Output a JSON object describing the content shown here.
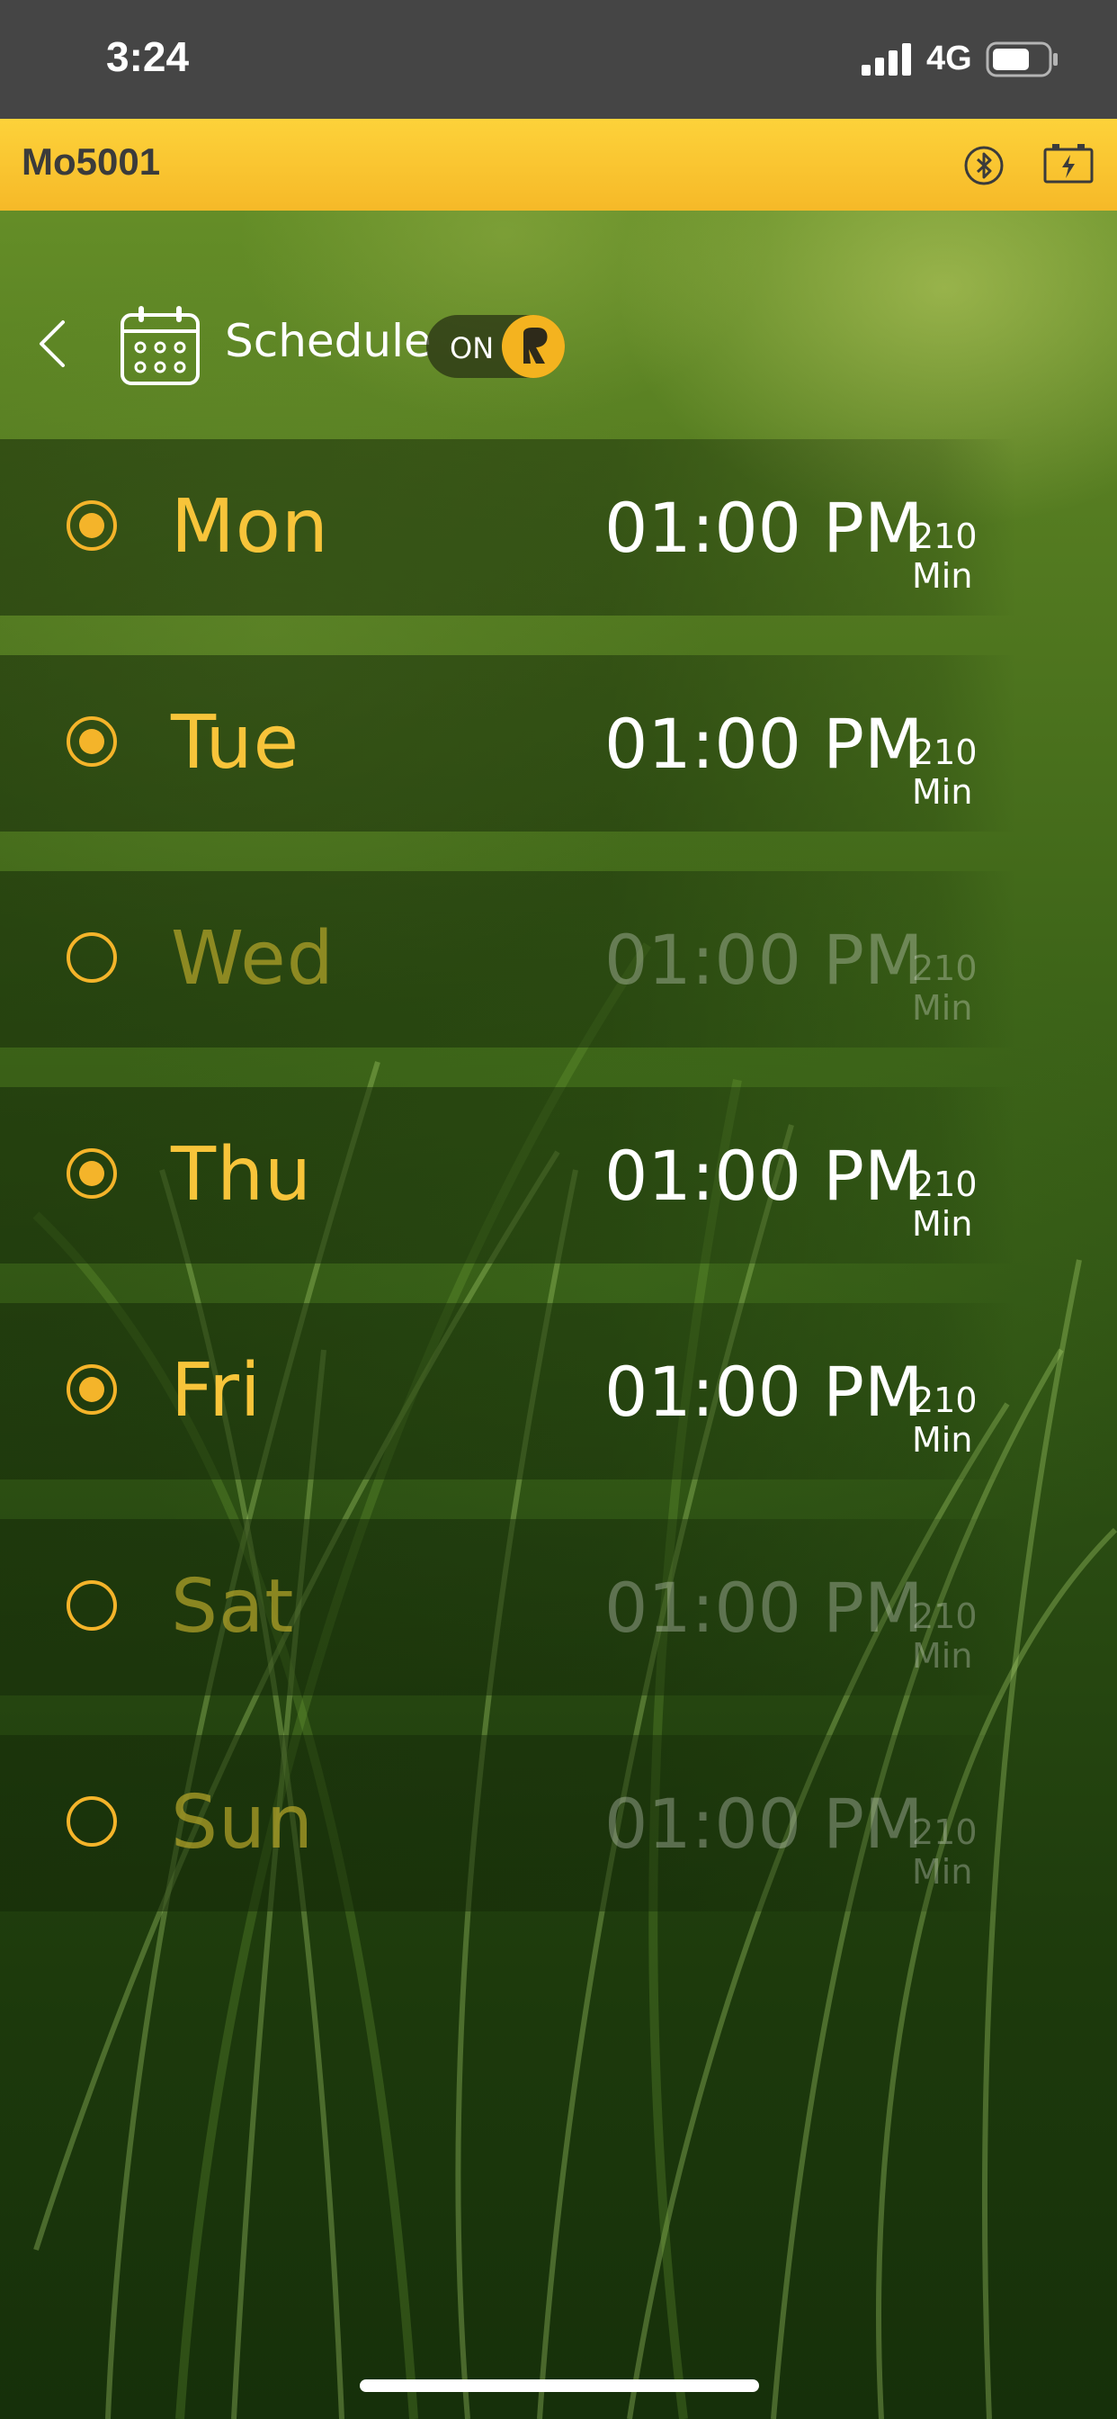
{
  "status_bar": {
    "time": "3:24",
    "network": "4G",
    "icons": [
      "signal-icon",
      "battery-icon"
    ]
  },
  "header": {
    "device_name": "Mo5001",
    "icons": [
      "bluetooth-icon",
      "battery-charge-icon"
    ],
    "background_color": "#f9c531"
  },
  "schedule": {
    "title": "Schedule",
    "toggle_label": "ON",
    "toggle_on": true,
    "accent_color": "#f4b42a",
    "days": [
      {
        "day": "Mon",
        "time": "01:00 PM",
        "duration": "210 Min",
        "enabled": true
      },
      {
        "day": "Tue",
        "time": "01:00 PM",
        "duration": "210 Min",
        "enabled": true
      },
      {
        "day": "Wed",
        "time": "01:00 PM",
        "duration": "210 Min",
        "enabled": false
      },
      {
        "day": "Thu",
        "time": "01:00 PM",
        "duration": "210 Min",
        "enabled": true
      },
      {
        "day": "Fri",
        "time": "01:00 PM",
        "duration": "210 Min",
        "enabled": true
      },
      {
        "day": "Sat",
        "time": "01:00 PM",
        "duration": "210 Min",
        "enabled": false
      },
      {
        "day": "Sun",
        "time": "01:00 PM",
        "duration": "210 Min",
        "enabled": false
      }
    ]
  }
}
